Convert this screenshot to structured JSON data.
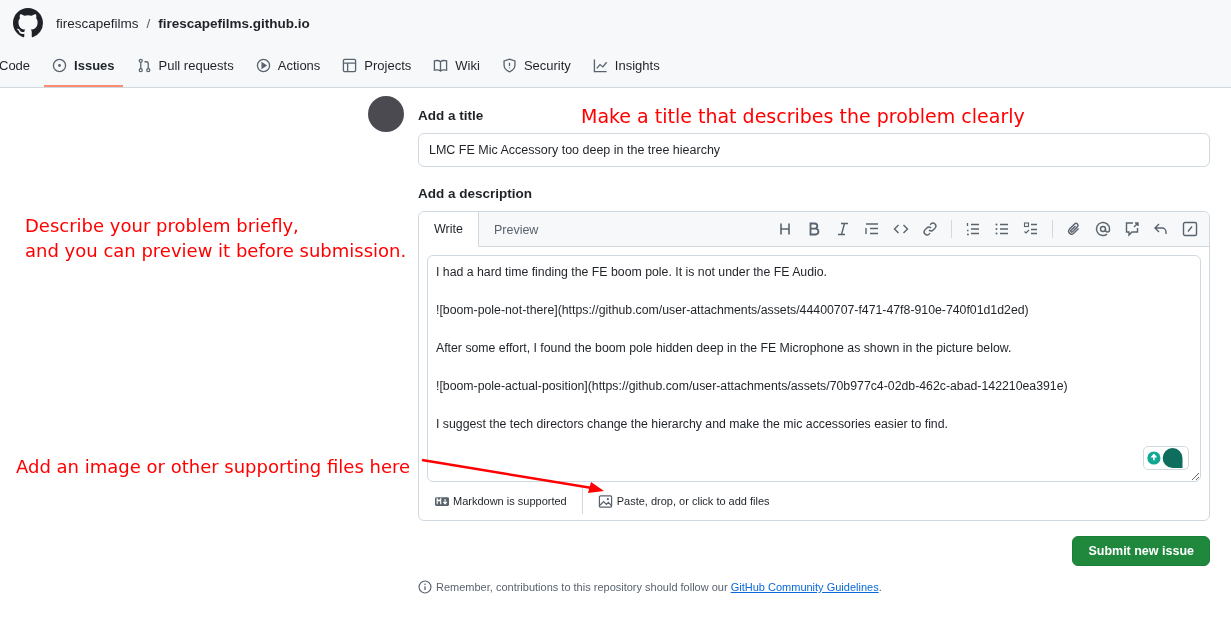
{
  "repo": {
    "owner": "firescapefilms",
    "separator": "/",
    "name": "firescapefilms.github.io"
  },
  "nav_tabs": [
    {
      "label": "Code",
      "selected": false
    },
    {
      "label": "Issues",
      "selected": true
    },
    {
      "label": "Pull requests",
      "selected": false
    },
    {
      "label": "Actions",
      "selected": false
    },
    {
      "label": "Projects",
      "selected": false
    },
    {
      "label": "Wiki",
      "selected": false
    },
    {
      "label": "Security",
      "selected": false
    },
    {
      "label": "Insights",
      "selected": false
    }
  ],
  "title_field": {
    "label": "Add a title",
    "value": "LMC FE Mic Accessory too deep in the tree hiearchy"
  },
  "description": {
    "label": "Add a description",
    "editor_tabs": [
      {
        "label": "Write",
        "selected": true
      },
      {
        "label": "Preview",
        "selected": false
      }
    ],
    "value": "I had a hard time finding the FE boom pole. It is not under the FE Audio.\n\n![boom-pole-not-there](https://github.com/user-attachments/assets/44400707-f471-47f8-910e-740f01d1d2ed)\n\nAfter some effort, I found the boom pole hidden deep in the FE Microphone as shown in the picture below.\n\n![boom-pole-actual-position](https://github.com/user-attachments/assets/70b977c4-02db-462c-abad-142210ea391e)\n\nI suggest the tech directors change the hierarchy and make the mic accessories easier to find.",
    "markdown_note": "Markdown is supported",
    "attach_note": "Paste, drop, or click to add files"
  },
  "submit_button": "Submit new issue",
  "footer_note": {
    "text": "Remember, contributions to this repository should follow our",
    "link": "GitHub Community Guidelines",
    "end": "."
  },
  "annotations": [
    {
      "kind": "title",
      "text": "Make a title that describes the problem clearly"
    },
    {
      "kind": "description",
      "lines": [
        "Describe your problem briefly,",
        "and you can preview it before submission."
      ]
    },
    {
      "kind": "attach",
      "text": "Add an image or other supporting files here"
    }
  ]
}
